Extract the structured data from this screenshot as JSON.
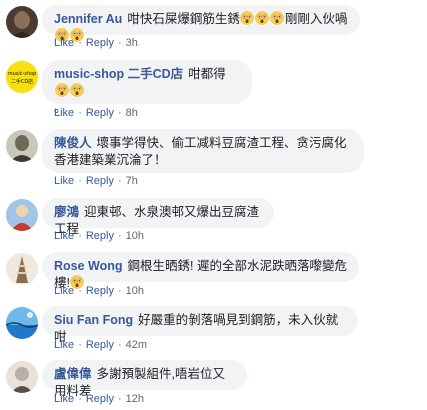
{
  "comments": [
    {
      "author": "Jennifer Au",
      "text_before": "咁快石屎爆鋼筋生銹",
      "emojis_mid": 3,
      "text_after": "剛剛入伙喎",
      "emojis_end": 2,
      "like": "Like",
      "reply": "Reply",
      "time": "3h",
      "avatar_colors": [
        "#4b3a2f",
        "#2e2a28",
        "#8c6f5a"
      ]
    },
    {
      "author": "music-shop 二手CD店",
      "text": "咁都得",
      "emojis_end": 2,
      "text_line2": "。",
      "avatar_text_top": "music-shop",
      "avatar_text_bottom": "二手CD店",
      "like": "Like",
      "reply": "Reply",
      "time": "8h",
      "avatar_colors": [
        "#f7e010",
        "#111111"
      ]
    },
    {
      "author": "陳俊人",
      "text": "壞事学得快、偷工减料豆腐渣工程、贪污腐化香港建築業沉淪了！",
      "like": "Like",
      "reply": "Reply",
      "time": "7h",
      "avatar_colors": [
        "#6b6b5a",
        "#c9c7b8",
        "#3c3a30"
      ]
    },
    {
      "author": "廖鴻",
      "text": "迎東邨、水泉澳邨又爆出豆腐渣工程",
      "like": "Like",
      "reply": "Reply",
      "time": "10h",
      "avatar_colors": [
        "#a3c4e6",
        "#c23b2d",
        "#f0d2b0"
      ]
    },
    {
      "author": "Rose Wong",
      "text": "鋼根生晒銹! 遲的全部水泥跌晒落嚟變危樓!",
      "emojis_end": 1,
      "like": "Like",
      "reply": "Reply",
      "time": "10h",
      "avatar_colors": [
        "#d9cfc0",
        "#8a6e4b",
        "#efe8dc"
      ]
    },
    {
      "author": "Siu Fan Fong",
      "text": "好嚴重的剝落喎見到鋼筋，未入伙就咁",
      "like": "Like",
      "reply": "Reply",
      "time": "42m",
      "avatar_colors": [
        "#1f78c8",
        "#6cb9ea",
        "#0a3e6e"
      ]
    },
    {
      "author": "盧偉偉",
      "text": "多謝預製組件,唔岩位又用料差",
      "like": "Like",
      "reply": "Reply",
      "time": "12h",
      "avatar_colors": [
        "#b8b0a6",
        "#5b4e43",
        "#e8e2da"
      ]
    }
  ],
  "colors": {
    "author": "#385898",
    "bubble": "#f2f3f5",
    "text": "#1c1e21",
    "meta": "#606770",
    "emoji_face": "#ffcc4d"
  },
  "icons": {
    "emoji": "astonished-face-emoji"
  }
}
